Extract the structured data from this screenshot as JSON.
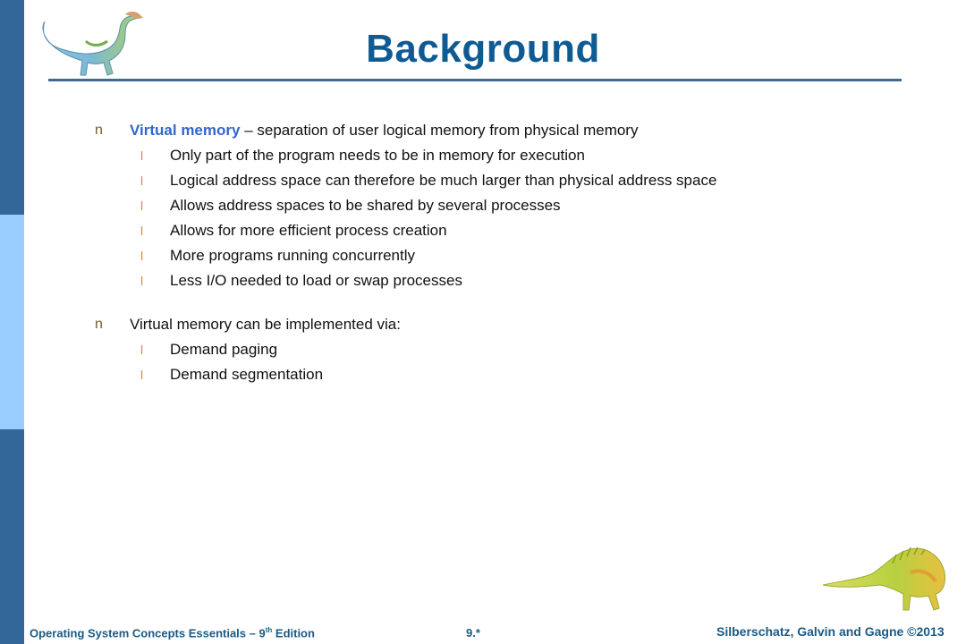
{
  "slide": {
    "title": "Background",
    "bullets": [
      {
        "marker": "n",
        "term": "Virtual memory",
        "text": " – separation of user logical memory from physical memory",
        "sub": [
          {
            "marker": "l",
            "text": "Only part of the program needs to be in memory for execution"
          },
          {
            "marker": "l",
            "text": "Logical address space can therefore be much larger than physical address space"
          },
          {
            "marker": "l",
            "text": "Allows address spaces to be shared by several processes"
          },
          {
            "marker": "l",
            "text": "Allows for more efficient process creation"
          },
          {
            "marker": "l",
            "text": "More programs running concurrently"
          },
          {
            "marker": "l",
            "text": "Less I/O needed to load or swap processes"
          }
        ]
      },
      {
        "marker": "n",
        "term": "",
        "text": "Virtual memory can be implemented via:",
        "sub": [
          {
            "marker": "l",
            "text": "Demand paging"
          },
          {
            "marker": "l",
            "text": "Demand segmentation"
          }
        ]
      }
    ]
  },
  "footer": {
    "book_prefix": "Operating System Concepts Essentials – 9",
    "book_sup": "th",
    "book_suffix": " Edition",
    "slide_number": "9.*",
    "copyright": "Silberschatz, Galvin and Gagne ©2013"
  },
  "colors": {
    "sidebar": "#336699",
    "sidebar_highlight": "#99ccff",
    "title": "#0e5b93",
    "term": "#3366cc",
    "footer": "#1a5a85"
  },
  "images": {
    "top_left": "dinosaur-icon",
    "bottom_right": "dinosaur-icon"
  }
}
